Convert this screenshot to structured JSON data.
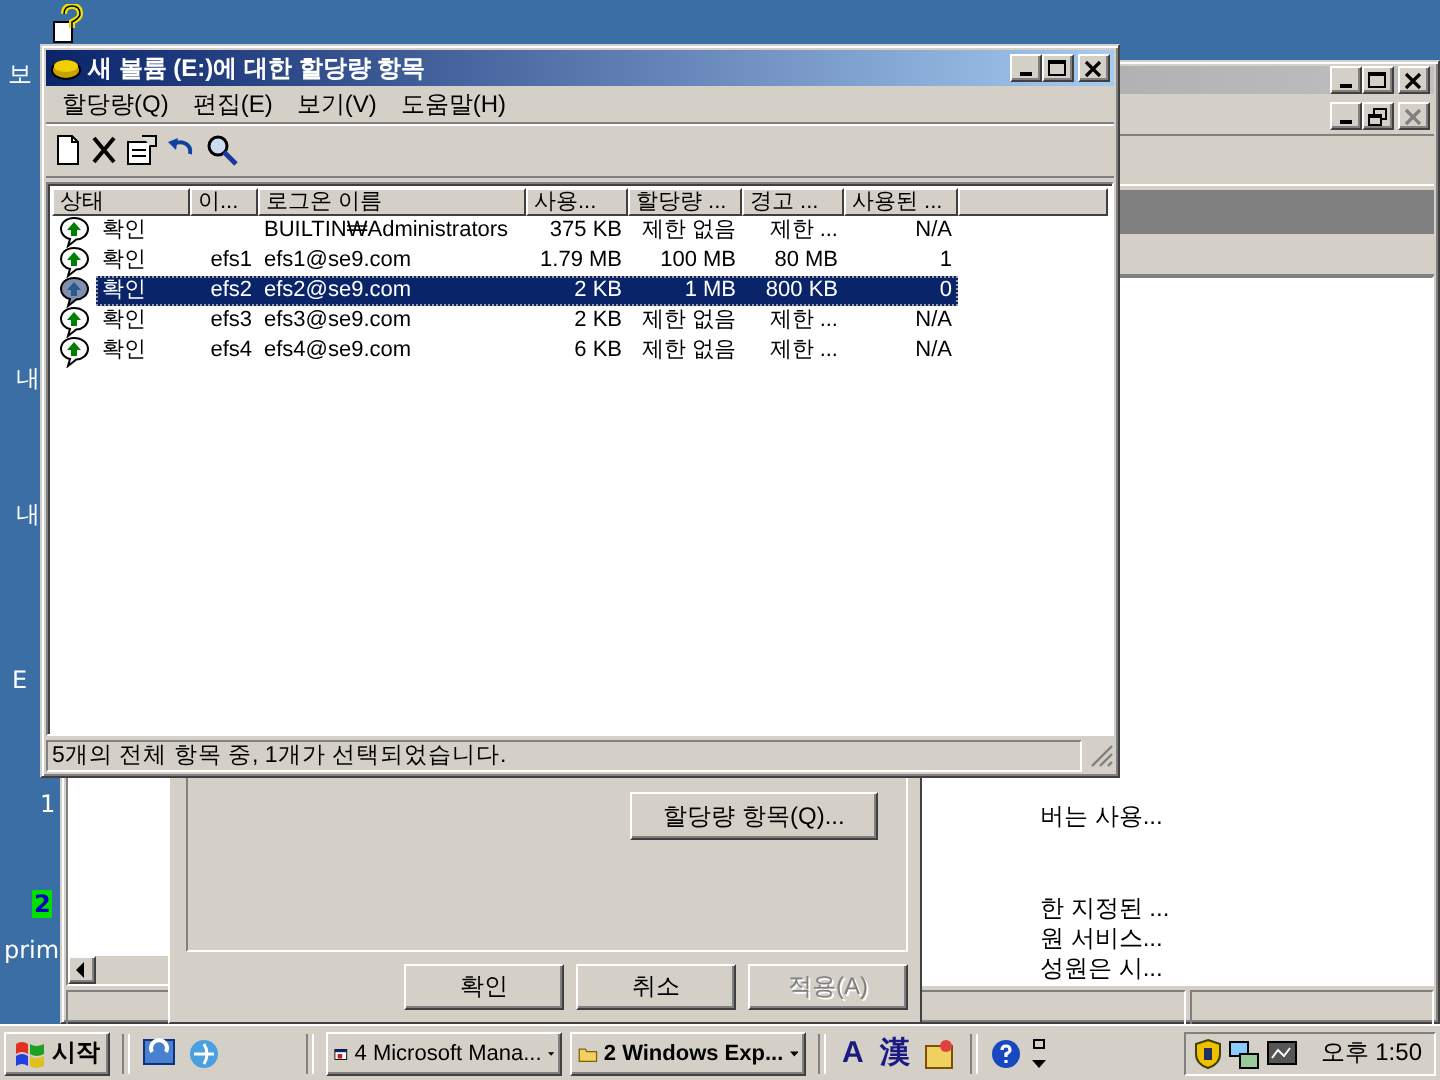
{
  "desktop": {
    "icon_labels": [
      {
        "text": "보",
        "highlighted": false
      },
      {
        "text": "내",
        "highlighted": false
      },
      {
        "text": "내",
        "highlighted": false
      },
      {
        "text": "E",
        "highlighted": false
      },
      {
        "text": "1",
        "highlighted": false
      },
      {
        "text": "2",
        "highlighted": true
      },
      {
        "text": "prim",
        "highlighted": false
      }
    ]
  },
  "mmc_window": {
    "list_texts": [
      "버는 사용...",
      "한 지정된 ...",
      "원 서비스...",
      "성원은 시..."
    ]
  },
  "properties_dialog": {
    "quota_entries_button": "할당량 항목(Q)...",
    "buttons": [
      {
        "label": "확인",
        "disabled": false
      },
      {
        "label": "취소",
        "disabled": false
      },
      {
        "label": "적용(A)",
        "disabled": true
      }
    ]
  },
  "quota_window": {
    "title": "새 볼륨 (E:)에 대한 할당량 항목",
    "menu": [
      "할당량(Q)",
      "편집(E)",
      "보기(V)",
      "도움말(H)"
    ],
    "columns": [
      "상태",
      "이...",
      "로그온 이름",
      "사용...",
      "할당량 ...",
      "경고 ...",
      "사용된 ..."
    ],
    "rows": [
      {
        "status": "확인",
        "logon_name": "BUILTIN₩Administrators",
        "used": "375 KB",
        "quota_limit": "제한 없음",
        "warning_level": "제한 ...",
        "percent_used": "N/A",
        "selected": false
      },
      {
        "status": "확인",
        "name": "efs1",
        "logon_name": "efs1@se9.com",
        "used": "1.79 MB",
        "quota_limit": "100 MB",
        "warning_level": "80 MB",
        "percent_used": "1",
        "selected": false
      },
      {
        "status": "확인",
        "name": "efs2",
        "logon_name": "efs2@se9.com",
        "used": "2 KB",
        "quota_limit": "1 MB",
        "warning_level": "800 KB",
        "percent_used": "0",
        "selected": true
      },
      {
        "status": "확인",
        "name": "efs3",
        "logon_name": "efs3@se9.com",
        "used": "2 KB",
        "quota_limit": "제한 없음",
        "warning_level": "제한 ...",
        "percent_used": "N/A",
        "selected": false
      },
      {
        "status": "확인",
        "name": "efs4",
        "logon_name": "efs4@se9.com",
        "used": "6 KB",
        "quota_limit": "제한 없음",
        "warning_level": "제한 ...",
        "percent_used": "N/A",
        "selected": false
      }
    ],
    "status_bar": "5개의 전체 항목 중, 1개가 선택되었습니다."
  },
  "taskbar": {
    "start": "시작",
    "tasks": [
      {
        "label": "4 Microsoft Mana...",
        "pressed": false
      },
      {
        "label": "2 Windows Exp...",
        "pressed": false
      }
    ],
    "tray_glyphs": [
      "A",
      "漢"
    ],
    "clock": "오후 1:50"
  }
}
